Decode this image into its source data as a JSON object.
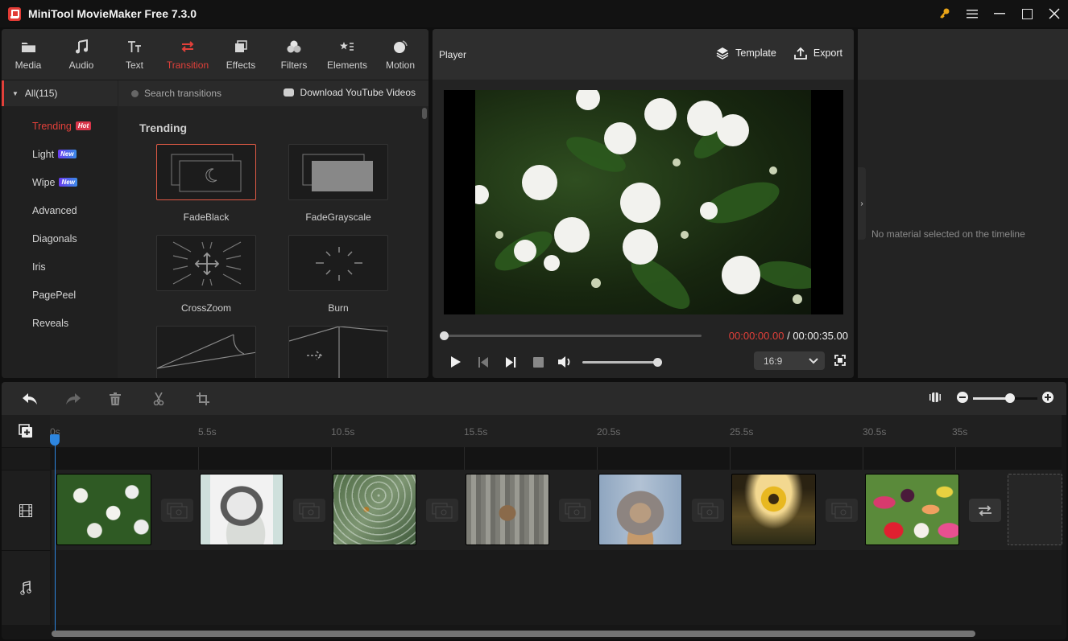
{
  "window": {
    "title": "MiniTool MovieMaker Free 7.3.0",
    "controls": [
      "key-icon",
      "menu-icon",
      "minimize-icon",
      "maximize-icon",
      "close-icon"
    ]
  },
  "tabs": [
    {
      "label": "Media",
      "icon": "folder-icon",
      "active": false
    },
    {
      "label": "Audio",
      "icon": "music-icon",
      "active": false
    },
    {
      "label": "Text",
      "icon": "text-icon",
      "active": false
    },
    {
      "label": "Transition",
      "icon": "transition-icon",
      "active": true
    },
    {
      "label": "Effects",
      "icon": "effects-icon",
      "active": false
    },
    {
      "label": "Filters",
      "icon": "filters-icon",
      "active": false
    },
    {
      "label": "Elements",
      "icon": "elements-icon",
      "active": false
    },
    {
      "label": "Motion",
      "icon": "motion-icon",
      "active": false
    }
  ],
  "categories": {
    "all_label": "All(115)",
    "items": [
      {
        "label": "Trending",
        "badge": "Hot",
        "active": true
      },
      {
        "label": "Light",
        "badge": "New",
        "active": false
      },
      {
        "label": "Wipe",
        "badge": "New",
        "active": false
      },
      {
        "label": "Advanced",
        "badge": null,
        "active": false
      },
      {
        "label": "Diagonals",
        "badge": null,
        "active": false
      },
      {
        "label": "Iris",
        "badge": null,
        "active": false
      },
      {
        "label": "PagePeel",
        "badge": null,
        "active": false
      },
      {
        "label": "Reveals",
        "badge": null,
        "active": false
      }
    ]
  },
  "library": {
    "search_placeholder": "Search transitions",
    "download_label": "Download YouTube Videos",
    "section_title": "Trending",
    "transitions": [
      {
        "label": "FadeBlack",
        "selected": true
      },
      {
        "label": "FadeGrayscale",
        "selected": false
      },
      {
        "label": "CrossZoom",
        "selected": false
      },
      {
        "label": "Burn",
        "selected": false
      },
      {
        "label": "",
        "selected": false
      },
      {
        "label": "",
        "selected": false
      }
    ]
  },
  "player": {
    "title": "Player",
    "template_label": "Template",
    "export_label": "Export",
    "current_time": "00:00:00.00",
    "separator": " / ",
    "total_time": "00:00:35.00",
    "progress": 0,
    "volume": 1.0,
    "aspect_ratio": "16:9"
  },
  "properties": {
    "empty_message": "No material selected on the timeline"
  },
  "timeline": {
    "ruler_labels": [
      "0s",
      "5.5s",
      "10.5s",
      "15.5s",
      "20.5s",
      "25.5s",
      "30.5s",
      "35s"
    ],
    "zoom_level": 0.58,
    "clips": [
      {
        "name": "white-flowers"
      },
      {
        "name": "shih-tzu-dog"
      },
      {
        "name": "spider-web"
      },
      {
        "name": "bird-feeder"
      },
      {
        "name": "squirrel"
      },
      {
        "name": "sunflower"
      },
      {
        "name": "tulips"
      }
    ],
    "playhead_time": "0s"
  },
  "colors": {
    "accent": "#e2403a",
    "playhead": "#2d86e0",
    "badge_hot": "#d9354a"
  }
}
